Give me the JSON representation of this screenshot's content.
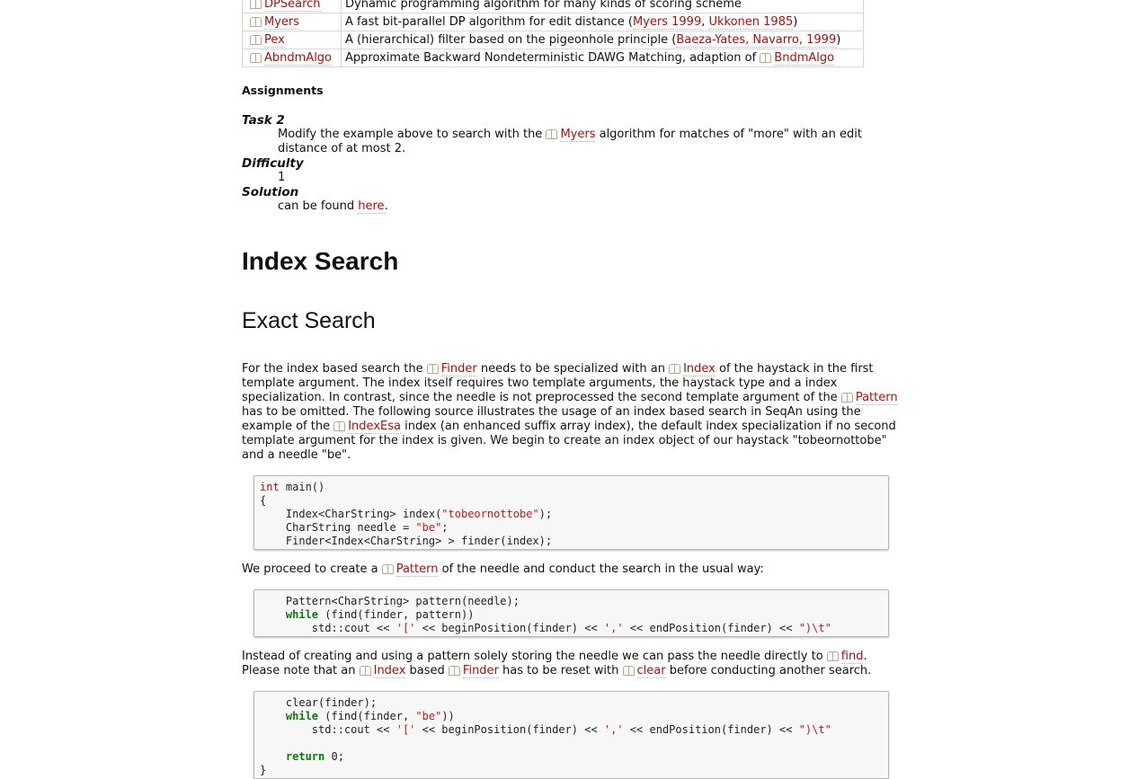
{
  "algo_table": {
    "rows": [
      {
        "name": "DPSearch",
        "desc": [
          {
            "t": "Dynamic programming algorithm for many kinds of scoring scheme"
          }
        ]
      },
      {
        "name": "Myers",
        "desc": [
          {
            "t": "A fast bit-parallel DP algorithm for edit distance ("
          },
          {
            "t": "Myers 1999",
            "link": true
          },
          {
            "t": ", "
          },
          {
            "t": "Ukkonen 1985",
            "link": true
          },
          {
            "t": ")"
          }
        ]
      },
      {
        "name": "Pex",
        "desc": [
          {
            "t": "A (hierarchical) filter based on the pigeonhole principle ("
          },
          {
            "t": "Baeza-Yates, Navarro, 1999",
            "link": true
          },
          {
            "t": ")"
          }
        ]
      },
      {
        "name": "AbndmAlgo",
        "desc": [
          {
            "t": "Approximate Backward Nondeterministic DAWG Matching, adaption of "
          },
          {
            "t": "BndmAlgo",
            "link": true,
            "icon": true
          }
        ]
      }
    ]
  },
  "assignments": {
    "heading": "Assignments",
    "task_label": "Task 2",
    "task_pre": "Modify the example above to search with the ",
    "task_link": "Myers",
    "task_post": " algorithm for matches of \"more\" with an edit",
    "task_line2": "distance of at most 2.",
    "difficulty_label": "Difficulty",
    "difficulty_value": "1",
    "solution_label": "Solution",
    "solution_pre": "can be found ",
    "solution_link": "here",
    "solution_post": "."
  },
  "index_search": {
    "title": "Index Search",
    "exact_title": "Exact Search",
    "para1": [
      {
        "t": "For the index based search the "
      },
      {
        "t": "Finder",
        "link": true,
        "icon": true
      },
      {
        "t": " needs to be specialized with an "
      },
      {
        "t": "Index",
        "link": true,
        "icon": true
      },
      {
        "t": " of the haystack in the first template argument. The index itself requires two template arguments, the haystack type and a index specialization. In contrast, since the needle is not preprocessed the second template argument of the "
      },
      {
        "t": "Pattern",
        "link": true,
        "icon": true
      },
      {
        "t": " has to be omitted. The following source illustrates the usage of an index based search in SeqAn using the example of the "
      },
      {
        "t": "IndexEsa",
        "link": true,
        "icon": true
      },
      {
        "t": " index (an enhanced suffix array index), the default index specialization if no second template argument for the index is given. We begin to create an index object of our haystack \"tobeornottobe\" and a needle \"be\"."
      }
    ],
    "code1": [
      [
        {
          "c": "kw",
          "t": "int"
        },
        {
          "t": " main()"
        }
      ],
      [
        {
          "t": "{"
        }
      ],
      [
        {
          "t": "    Index<CharString> index("
        },
        {
          "c": "str",
          "t": "\"tobeornottobe\""
        },
        {
          "t": ");"
        }
      ],
      [
        {
          "t": "    CharString needle = "
        },
        {
          "c": "str",
          "t": "\"be\""
        },
        {
          "t": ";"
        }
      ],
      [
        {
          "t": "    Finder<Index<CharString> > finder(index);"
        }
      ]
    ],
    "para2": [
      {
        "t": "We proceed to create a "
      },
      {
        "t": "Pattern",
        "link": true,
        "icon": true
      },
      {
        "t": " of the needle and conduct the search in the usual way:"
      }
    ],
    "code2": [
      [
        {
          "t": "    Pattern<CharString> pattern(needle);"
        }
      ],
      [
        {
          "t": "    "
        },
        {
          "c": "kwb",
          "t": "while"
        },
        {
          "t": " (find(finder, pattern))"
        }
      ],
      [
        {
          "t": "        std::cout << "
        },
        {
          "c": "str",
          "t": "'['"
        },
        {
          "t": " << beginPosition(finder) << "
        },
        {
          "c": "str",
          "t": "','"
        },
        {
          "t": " << endPosition(finder) << "
        },
        {
          "c": "str",
          "t": "\")\\t\""
        }
      ]
    ],
    "para3": [
      {
        "t": "Instead of creating and using a pattern solely storing the needle we can pass the needle directly to "
      },
      {
        "t": "find",
        "link": true,
        "icon": true
      },
      {
        "t": ". Please note that an "
      },
      {
        "t": "Index",
        "link": true,
        "icon": true
      },
      {
        "t": " based "
      },
      {
        "t": "Finder",
        "link": true,
        "icon": true
      },
      {
        "t": " has to be reset with "
      },
      {
        "t": "clear",
        "link": true,
        "icon": true
      },
      {
        "t": " before conducting another search."
      }
    ],
    "code3": [
      [
        {
          "t": "    clear(finder);"
        }
      ],
      [
        {
          "t": "    "
        },
        {
          "c": "kwb",
          "t": "while"
        },
        {
          "t": " (find(finder, "
        },
        {
          "c": "str",
          "t": "\"be\""
        },
        {
          "t": "))"
        }
      ],
      [
        {
          "t": "        std::cout << "
        },
        {
          "c": "str",
          "t": "'['"
        },
        {
          "t": " << beginPosition(finder) << "
        },
        {
          "c": "str",
          "t": "','"
        },
        {
          "t": " << endPosition(finder) << "
        },
        {
          "c": "str",
          "t": "\")\\t\""
        }
      ],
      [
        {
          "t": ""
        }
      ],
      [
        {
          "t": "    "
        },
        {
          "c": "kwb",
          "t": "return"
        },
        {
          "t": " 0;"
        }
      ],
      [
        {
          "t": "}"
        }
      ]
    ]
  }
}
